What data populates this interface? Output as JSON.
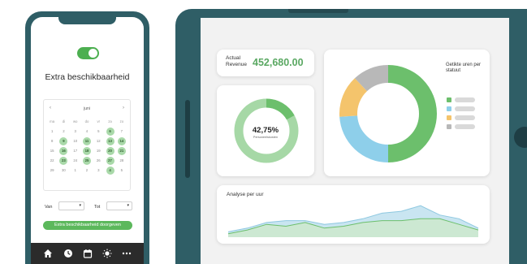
{
  "phone": {
    "title": "Extra beschikbaarheid",
    "calendar": {
      "month": "juni",
      "prev_icon": "chevron-left-icon",
      "next_icon": "chevron-right-icon",
      "weekdays": [
        "ma",
        "di",
        "wo",
        "do",
        "vr",
        "za",
        "zo"
      ],
      "days": [
        {
          "label": "1",
          "highlight": false
        },
        {
          "label": "2",
          "highlight": false
        },
        {
          "label": "3",
          "highlight": false
        },
        {
          "label": "4",
          "highlight": false
        },
        {
          "label": "5",
          "highlight": false
        },
        {
          "label": "6",
          "highlight": true
        },
        {
          "label": "7",
          "highlight": false
        },
        {
          "label": "8",
          "highlight": false
        },
        {
          "label": "9",
          "highlight": true
        },
        {
          "label": "10",
          "highlight": false
        },
        {
          "label": "11",
          "highlight": true
        },
        {
          "label": "12",
          "highlight": false
        },
        {
          "label": "13",
          "highlight": true
        },
        {
          "label": "14",
          "highlight": true
        },
        {
          "label": "15",
          "highlight": false
        },
        {
          "label": "16",
          "highlight": true
        },
        {
          "label": "17",
          "highlight": false
        },
        {
          "label": "18",
          "highlight": true
        },
        {
          "label": "19",
          "highlight": false
        },
        {
          "label": "20",
          "highlight": true
        },
        {
          "label": "21",
          "highlight": true
        },
        {
          "label": "22",
          "highlight": false
        },
        {
          "label": "23",
          "highlight": true
        },
        {
          "label": "24",
          "highlight": false
        },
        {
          "label": "25",
          "highlight": true
        },
        {
          "label": "26",
          "highlight": false
        },
        {
          "label": "27",
          "highlight": true
        },
        {
          "label": "28",
          "highlight": false
        },
        {
          "label": "29",
          "highlight": false
        },
        {
          "label": "30",
          "highlight": false
        },
        {
          "label": "1",
          "highlight": false
        },
        {
          "label": "2",
          "highlight": false
        },
        {
          "label": "3",
          "highlight": false
        },
        {
          "label": "4",
          "highlight": true
        },
        {
          "label": "5",
          "highlight": false
        }
      ]
    },
    "from_label": "Van",
    "to_label": "Tot",
    "add_button": "Extra beschikbaarheid doorgeven",
    "tabbar_icons": [
      "home-icon",
      "clock-icon",
      "calendar-icon",
      "sun-icon",
      "more-icon"
    ],
    "toggle_on": true
  },
  "dashboard": {
    "revenue_label_line1": "Actual",
    "revenue_label_line2": "Revenue",
    "revenue_value": "452,680.00",
    "percentage_value": "42,75%",
    "percentage_label": "Personeelskosten",
    "percentage_fraction": 0.17,
    "donut_title": "Getikte uren per statuut",
    "hourly_title": "Analyse per uur"
  },
  "colors": {
    "frame": "#2f5e66",
    "green": "#5cb85c",
    "blue": "#8ecfea",
    "orange": "#f4c46c",
    "gray": "#b8b8b8",
    "light_green": "#a6d8a6"
  },
  "chart_data": [
    {
      "type": "pie",
      "title": "Getikte uren per statuut",
      "values": [
        50,
        24,
        14,
        12
      ],
      "colors": [
        "#6cbf6c",
        "#8ecfea",
        "#f4c46c",
        "#b8b8b8"
      ]
    },
    {
      "type": "area",
      "title": "Analyse per uur",
      "x": [
        0,
        1,
        2,
        3,
        4,
        5,
        6,
        7,
        8,
        9,
        10,
        11,
        12,
        13
      ],
      "series": [
        {
          "values": [
            2,
            4,
            7,
            8,
            8,
            6,
            7,
            9,
            12,
            13,
            16,
            11,
            9,
            4
          ]
        },
        {
          "values": [
            1,
            3,
            6,
            5,
            7,
            4,
            5,
            7,
            8,
            8,
            9,
            9,
            6,
            3
          ]
        }
      ],
      "ylim": [
        0,
        20
      ]
    }
  ]
}
